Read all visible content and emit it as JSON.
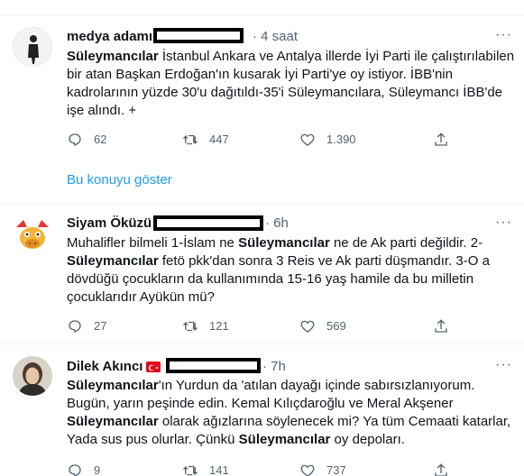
{
  "tweets": [
    {
      "name": "medya adamı",
      "time": "4 saat",
      "more": "···",
      "text_parts": [
        {
          "b": true,
          "t": "Süleymancılar"
        },
        {
          "b": false,
          "t": " İstanbul Ankara ve Antalya illerde İyi Parti ile çalıştırılabilen bir atan Başkan Erdoğan'ın kusarak İyi Parti'ye oy istiyor. İBB'nin kadrolarının yüzde 30'u dağıtıldı-35'i Süleymancılara, Süleymancı İBB'de işe alındı. +"
        }
      ],
      "replies": "62",
      "retweets": "447",
      "likes": "1.390",
      "show_thread": "Bu konuyu göster"
    },
    {
      "name": "Siyam Öküzü",
      "time": "6h",
      "more": "···",
      "text_parts": [
        {
          "b": false,
          "t": "Muhalifler bilmeli 1-İslam ne "
        },
        {
          "b": true,
          "t": "Süleymancılar"
        },
        {
          "b": false,
          "t": " ne de Ak parti değildir. 2-"
        },
        {
          "b": true,
          "t": "Süleymancılar"
        },
        {
          "b": false,
          "t": " fetö pkk'dan sonra 3 Reis ve Ak parti düşmandır. 3-O a dövdüğü çocukların da kullanımında 15-16 yaş hamile da bu milletin çocuklarıdır Ayükün mü?"
        }
      ],
      "replies": "27",
      "retweets": "121",
      "likes": "569"
    },
    {
      "name": "Dilek Akıncı",
      "time": "7h",
      "more": "···",
      "text_parts": [
        {
          "b": true,
          "t": "Süleymancılar"
        },
        {
          "b": false,
          "t": "'ın Yurdun da 'atılan dayağı içinde sabırsızlanıyorum. Bugün, yarın peşinde edin. Kemal Kılıçdaroğlu ve Meral Akşener "
        },
        {
          "b": true,
          "t": "Süleymancılar"
        },
        {
          "b": false,
          "t": " olarak ağızlarına söylenecek mi? Ya tüm Cemaati katarlar, Yada sus pus olurlar. Çünkü "
        },
        {
          "b": true,
          "t": "Süleymancılar"
        },
        {
          "b": false,
          "t": " oy depoları."
        }
      ],
      "replies": "9",
      "retweets": "141",
      "likes": "737"
    }
  ],
  "colors": {
    "accent": "#1d9bf0",
    "muted": "#536471",
    "text": "#0f1419",
    "separator": "#eff3f4",
    "flag": "#e30a17"
  },
  "icons": [
    "reply-icon",
    "retweet-icon",
    "like-icon",
    "share-icon",
    "more-icon",
    "turkey-flag-icon"
  ]
}
